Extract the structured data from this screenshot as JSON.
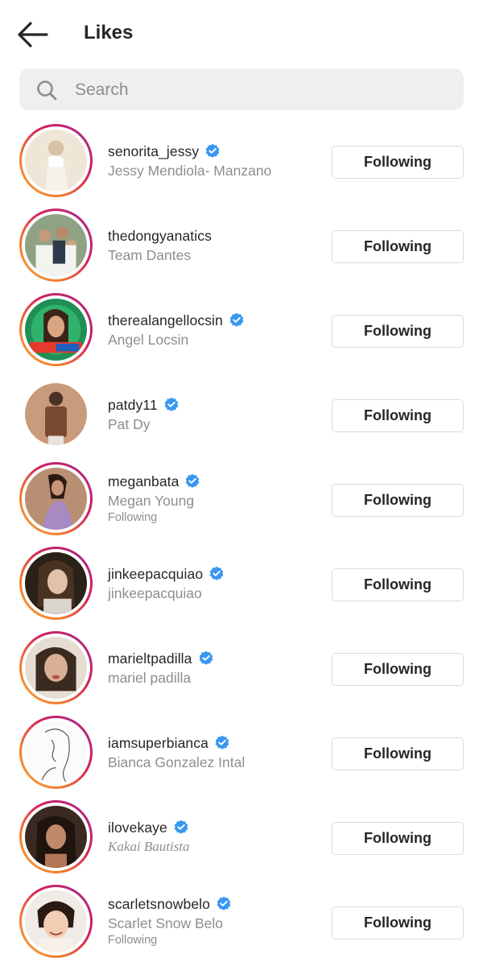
{
  "header": {
    "title": "Likes",
    "back_icon": "arrow-left-icon"
  },
  "search": {
    "placeholder": "Search",
    "value": "",
    "icon": "search-icon"
  },
  "colors": {
    "verified": "#3897f0",
    "secondary_text": "#8e8e8e",
    "button_border": "#dbdbdb",
    "story_ring": [
      "#f9a23c",
      "#d3205b",
      "#a12b8f"
    ]
  },
  "users": [
    {
      "username": "senorita_jessy",
      "full_name": "Jessy Mendiola- Manzano",
      "verified": true,
      "subtext": "",
      "button": "Following",
      "story_ring": true
    },
    {
      "username": "thedongyanatics",
      "full_name": "Team Dantes",
      "verified": false,
      "subtext": "",
      "button": "Following",
      "story_ring": true
    },
    {
      "username": "therealangellocsin",
      "full_name": "Angel Locsin",
      "verified": true,
      "subtext": "",
      "button": "Following",
      "story_ring": true
    },
    {
      "username": "patdy11",
      "full_name": "Pat Dy",
      "verified": true,
      "subtext": "",
      "button": "Following",
      "story_ring": false
    },
    {
      "username": "meganbata",
      "full_name": "Megan Young",
      "verified": true,
      "subtext": "Following",
      "button": "Following",
      "story_ring": true
    },
    {
      "username": "jinkeepacquiao",
      "full_name": "jinkeepacquiao",
      "verified": true,
      "subtext": "",
      "button": "Following",
      "story_ring": true
    },
    {
      "username": "marieltpadilla",
      "full_name": "mariel padilla",
      "verified": true,
      "subtext": "",
      "button": "Following",
      "story_ring": true
    },
    {
      "username": "iamsuperbianca",
      "full_name": "Bianca Gonzalez Intal",
      "verified": true,
      "subtext": "",
      "button": "Following",
      "story_ring": true
    },
    {
      "username": "ilovekaye",
      "full_name": "Kakai Bautista",
      "verified": true,
      "subtext": "",
      "button": "Following",
      "story_ring": true
    },
    {
      "username": "scarletsnowbelo",
      "full_name": "Scarlet Snow Belo",
      "verified": true,
      "subtext": "Following",
      "button": "Following",
      "story_ring": true
    }
  ]
}
